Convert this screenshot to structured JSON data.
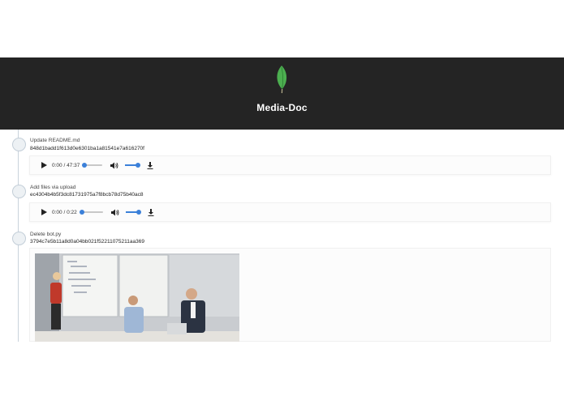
{
  "app": {
    "title": "Media-Doc",
    "logo_icon": "leaf-icon",
    "logo_color": "#4caf50"
  },
  "commits": [
    {
      "message": "Update README.md",
      "hash": "848d1badd1f613d0e6301ba1a81541e7a616270f",
      "media": {
        "type": "audio",
        "time": "0:00 / 47:37",
        "progress": 0,
        "volume": 1
      }
    },
    {
      "message": "Add files via upload",
      "hash": "ec4304b4b5f3dc81731975a7f8bcb78d75b40ac8",
      "media": {
        "type": "audio",
        "time": "0:00 / 0:22",
        "progress": 0,
        "volume": 1
      }
    },
    {
      "message": "Delete bot.py",
      "hash": "3794c7e5b11a8d0a04bb021f52211075211aa369",
      "media": {
        "type": "video"
      }
    }
  ],
  "colors": {
    "header_bg": "#242424",
    "accent": "#3b80d9",
    "timeline": "#c9d3dc"
  }
}
